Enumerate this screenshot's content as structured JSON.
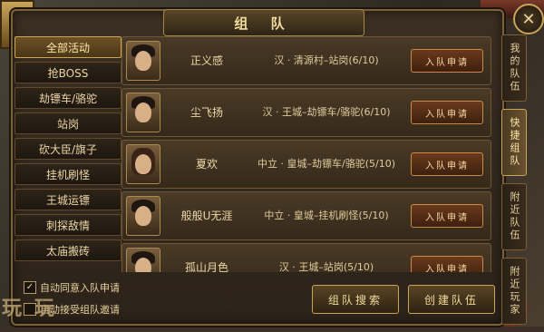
{
  "title": "组 队",
  "close_label": "✕",
  "categories": [
    {
      "label": "全部活动",
      "active": true
    },
    {
      "label": "抢BOSS",
      "active": false
    },
    {
      "label": "劫镖车/骆驼",
      "active": false
    },
    {
      "label": "站岗",
      "active": false
    },
    {
      "label": "砍大臣/旗子",
      "active": false
    },
    {
      "label": "挂机刷怪",
      "active": false
    },
    {
      "label": "王城运镖",
      "active": false
    },
    {
      "label": "刺探敌情",
      "active": false
    },
    {
      "label": "太庙搬砖",
      "active": false
    }
  ],
  "teams": [
    {
      "name": "正义感",
      "location": "汉 · 清源村–站岗(6/10)",
      "apply_label": "入队申请"
    },
    {
      "name": "尘飞扬",
      "location": "汉 · 王城–劫镖车/骆驼(6/10)",
      "apply_label": "入队申请"
    },
    {
      "name": "夏欢",
      "location": "中立 · 皇城–劫镖车/骆驼(5/10)",
      "apply_label": "入队申请"
    },
    {
      "name": "般般U无涯",
      "location": "中立 · 皇城–挂机刷怪(5/10)",
      "apply_label": "入队申请"
    },
    {
      "name": "孤山月色",
      "location": "汉 · 王城–站岗(5/10)",
      "apply_label": "入队申请"
    }
  ],
  "tabs": [
    {
      "label": "我的队伍",
      "active": false
    },
    {
      "label": "快捷组队",
      "active": true
    },
    {
      "label": "附近队伍",
      "active": false
    },
    {
      "label": "附近玩家",
      "active": false
    }
  ],
  "options": {
    "auto_accept_label": "自动同意入队申请",
    "auto_accept_checked": true,
    "auto_invite_label": "自动接受组队邀请",
    "auto_invite_checked": false
  },
  "buttons": {
    "team_search": "组队搜索",
    "create_team": "创建队伍"
  },
  "watermark": "玩玩"
}
